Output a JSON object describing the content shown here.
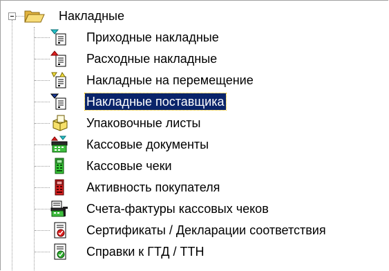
{
  "tree": {
    "root": {
      "label": "Накладные",
      "icon": "folder-open-icon",
      "expanded": true
    },
    "items": [
      {
        "label": "Приходные накладные",
        "icon": "incoming-invoice-icon",
        "name": "tree-item-incoming-invoices",
        "selected": false
      },
      {
        "label": "Расходные накладные",
        "icon": "outgoing-invoice-icon",
        "name": "tree-item-outgoing-invoices",
        "selected": false
      },
      {
        "label": "Накладные на перемещение",
        "icon": "transfer-invoice-icon",
        "name": "tree-item-transfer-invoices",
        "selected": false
      },
      {
        "label": "Накладные поставщика",
        "icon": "supplier-invoice-icon",
        "name": "tree-item-supplier-invoices",
        "selected": true
      },
      {
        "label": "Упаковочные листы",
        "icon": "packing-list-icon",
        "name": "tree-item-packing-lists",
        "selected": false
      },
      {
        "label": "Кассовые документы",
        "icon": "cash-documents-icon",
        "name": "tree-item-cash-documents",
        "selected": false
      },
      {
        "label": "Кассовые чеки",
        "icon": "cash-receipt-green-icon",
        "name": "tree-item-cash-receipts",
        "selected": false
      },
      {
        "label": "Активность покупателя",
        "icon": "customer-activity-red-icon",
        "name": "tree-item-customer-activity",
        "selected": false
      },
      {
        "label": "Счета-фактуры кассовых чеков",
        "icon": "receipt-invoice-icon",
        "name": "tree-item-receipt-invoices",
        "selected": false
      },
      {
        "label": "Сертификаты / Декларации соответствия",
        "icon": "certificate-icon",
        "name": "tree-item-certificates",
        "selected": false
      },
      {
        "label": "Справки к ГТД / ТТН",
        "icon": "customs-reference-icon",
        "name": "tree-item-customs-references",
        "selected": false
      }
    ]
  },
  "colors": {
    "selection_bg": "#0a246a",
    "selection_text": "#ffffff",
    "folder_yellow": "#f2d56b",
    "line_gray": "#9a9a9a"
  }
}
